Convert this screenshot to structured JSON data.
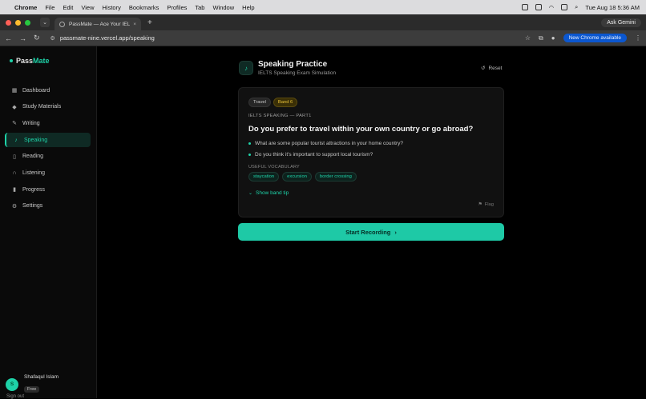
{
  "menubar": {
    "apple": "",
    "items": [
      "Chrome",
      "File",
      "Edit",
      "View",
      "History",
      "Bookmarks",
      "Profiles",
      "Tab",
      "Window",
      "Help"
    ],
    "clock": "Tue Aug 18  5:36 AM"
  },
  "browser": {
    "tab_title": "PassMate — Ace Your IELTS",
    "url": "passmate-nine.vercel.app/speaking",
    "ask_gemini": "Ask Gemini",
    "new_chrome": "New Chrome available"
  },
  "sidebar": {
    "brand_pass": "Pass",
    "brand_mate": "Mate",
    "items": [
      {
        "label": "Dashboard",
        "icon": "grid-icon"
      },
      {
        "label": "Study Materials",
        "icon": "graduation-cap-icon"
      },
      {
        "label": "Writing",
        "icon": "pen-icon"
      },
      {
        "label": "Speaking",
        "icon": "mic-icon",
        "active": true
      },
      {
        "label": "Reading",
        "icon": "book-icon"
      },
      {
        "label": "Listening",
        "icon": "headphones-icon"
      },
      {
        "label": "Progress",
        "icon": "bar-chart-icon"
      },
      {
        "label": "Settings",
        "icon": "gear-icon"
      }
    ],
    "user": {
      "initial": "S",
      "name": "Shafaqul Islam",
      "plan": "Free"
    },
    "signout": "Sign out"
  },
  "main": {
    "title": "Speaking Practice",
    "subtitle": "IELTS Speaking Exam Simulation",
    "reset": "Reset",
    "card": {
      "topic": "Travel",
      "band": "Band 6",
      "part": "IELTS SPEAKING — PART1",
      "question": "Do you prefer to travel within your own country or go abroad?",
      "followups": [
        "What are some popular tourist attractions in your home country?",
        "Do you think it's important to support local tourism?"
      ],
      "vocab_label": "USEFUL VOCABULARY",
      "vocab": [
        "staycation",
        "excursion",
        "border crossing"
      ],
      "band_tip": "Show band tip",
      "flag": "Flag"
    },
    "start_button": "Start Recording"
  },
  "colors": {
    "accent": "#1ed2a8",
    "band": "#e8c23a",
    "background": "#000000"
  }
}
